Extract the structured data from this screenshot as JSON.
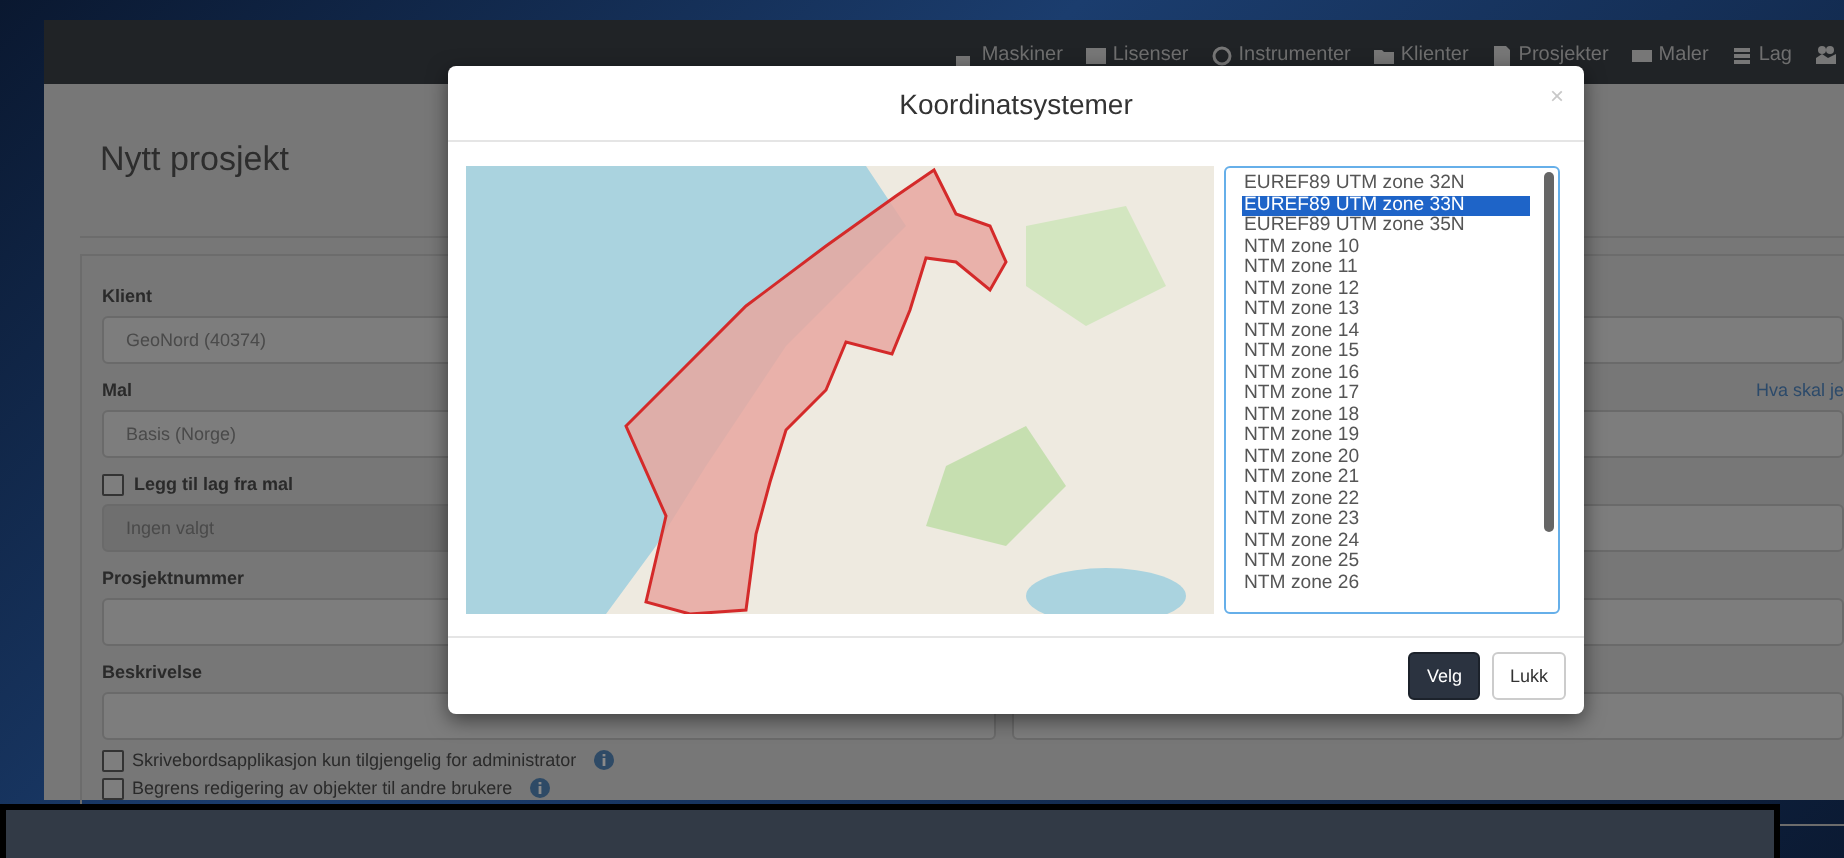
{
  "navbar": {
    "items": [
      {
        "label": "Maskiner"
      },
      {
        "label": "Lisenser"
      },
      {
        "label": "Instrumenter"
      },
      {
        "label": "Klienter"
      },
      {
        "label": "Prosjekter"
      },
      {
        "label": "Maler"
      },
      {
        "label": "Lag"
      }
    ]
  },
  "page": {
    "title": "Nytt prosjekt",
    "help_link": "Hva skal je",
    "fields": [
      {
        "kind": "select",
        "label": "Klient",
        "value": "GeoNord (40374)",
        "disabled": false
      },
      {
        "kind": "select",
        "label": "Mal",
        "value": "Basis (Norge)",
        "disabled": false
      },
      {
        "kind": "check",
        "label": "Legg til lag fra mal",
        "checked": false,
        "value": "Ingen valgt",
        "disabled": true
      },
      {
        "kind": "text",
        "label": "Prosjektnummer",
        "disabled": false
      },
      {
        "kind": "text",
        "label": "Beskrivelse",
        "disabled": false
      }
    ],
    "options": [
      {
        "label": "Skrivebordsapplikasjon kun tilgjengelig for administrator",
        "checked": false
      },
      {
        "label": "Begrens redigering av objekter til andre brukere",
        "checked": false
      }
    ]
  },
  "dialog": {
    "title": "Koordinatsystemer",
    "close": "×",
    "items": [
      {
        "label": "EUREF89 UTM zone 32N",
        "selected": false
      },
      {
        "label": "EUREF89 UTM zone 33N",
        "selected": true
      },
      {
        "label": "EUREF89 UTM zone 35N",
        "selected": false
      },
      {
        "label": "NTM zone 10",
        "selected": false
      },
      {
        "label": "NTM zone 11",
        "selected": false
      },
      {
        "label": "NTM zone 12",
        "selected": false
      },
      {
        "label": "NTM zone 13",
        "selected": false
      },
      {
        "label": "NTM zone 14",
        "selected": false
      },
      {
        "label": "NTM zone 15",
        "selected": false
      },
      {
        "label": "NTM zone 16",
        "selected": false
      },
      {
        "label": "NTM zone 17",
        "selected": false
      },
      {
        "label": "NTM zone 18",
        "selected": false
      },
      {
        "label": "NTM zone 19",
        "selected": false
      },
      {
        "label": "NTM zone 20",
        "selected": false
      },
      {
        "label": "NTM zone 21",
        "selected": false
      },
      {
        "label": "NTM zone 22",
        "selected": false
      },
      {
        "label": "NTM zone 23",
        "selected": false
      },
      {
        "label": "NTM zone 24",
        "selected": false
      },
      {
        "label": "NTM zone 25",
        "selected": false
      },
      {
        "label": "NTM zone 26",
        "selected": false
      }
    ],
    "buttons": [
      {
        "label": "Velg",
        "kind": "primary"
      },
      {
        "label": "Lukk",
        "kind": "default"
      }
    ]
  }
}
